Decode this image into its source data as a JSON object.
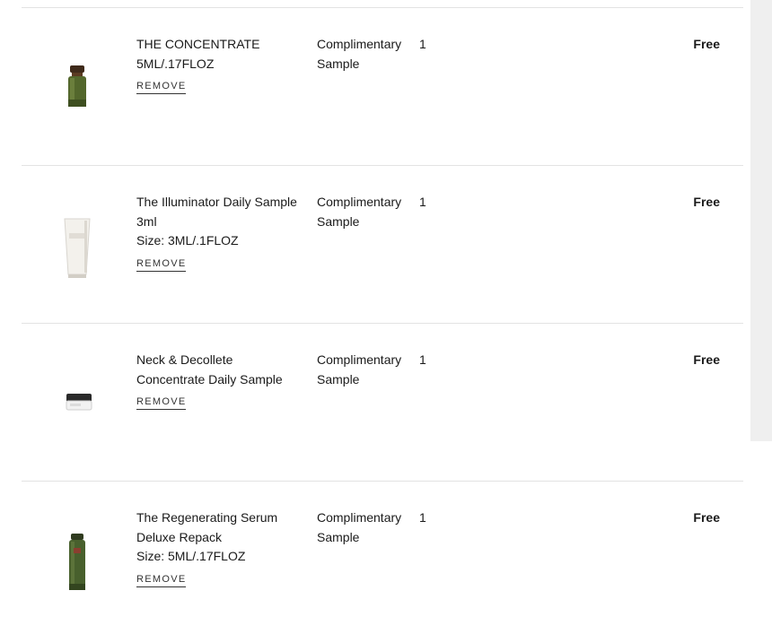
{
  "cart": {
    "items": [
      {
        "name_lines": [
          "THE CONCENTRATE",
          "5ML/.17FLOZ"
        ],
        "remove_label": "REMOVE",
        "type_lines": [
          "Complimentary",
          "Sample"
        ],
        "qty": "1",
        "price": "Free",
        "image": "green-serum-bottle"
      },
      {
        "name_lines": [
          "The Illuminator Daily Sample",
          "3ml",
          "Size: 3ML/.1FLOZ"
        ],
        "remove_label": "REMOVE",
        "type_lines": [
          "Complimentary",
          "Sample"
        ],
        "qty": "1",
        "price": "Free",
        "image": "white-tube"
      },
      {
        "name_lines": [
          "Neck & Decollete",
          "Concentrate Daily Sample"
        ],
        "remove_label": "REMOVE",
        "type_lines": [
          "Complimentary",
          "Sample"
        ],
        "qty": "1",
        "price": "Free",
        "image": "cream-jar"
      },
      {
        "name_lines": [
          "The Regenerating Serum",
          "Deluxe Repack",
          "Size: 5ML/.17FLOZ"
        ],
        "remove_label": "REMOVE",
        "type_lines": [
          "Complimentary",
          "Sample"
        ],
        "qty": "1",
        "price": "Free",
        "image": "tall-green-bottle"
      }
    ]
  }
}
